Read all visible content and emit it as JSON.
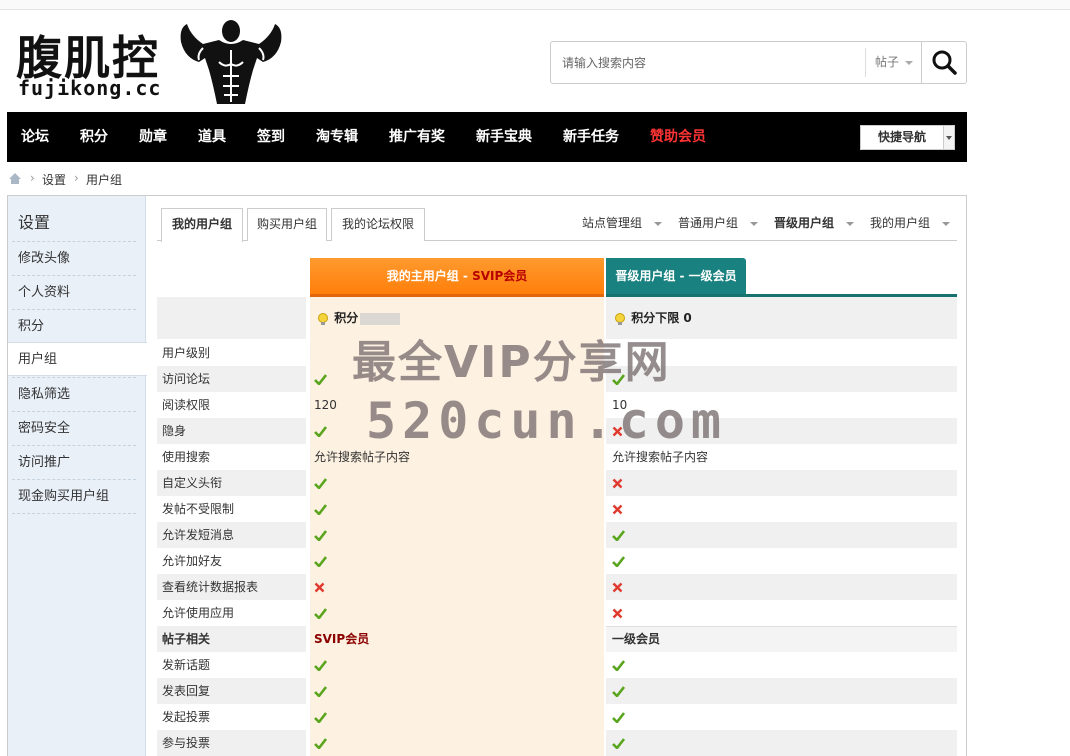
{
  "site": {
    "logo_cn": "腹肌控",
    "logo_en": "fujikong.cc"
  },
  "search": {
    "placeholder": "请输入搜索内容",
    "type_label": "帖子"
  },
  "nav": {
    "items": [
      "论坛",
      "积分",
      "勋章",
      "道具",
      "签到",
      "淘专辑",
      "推广有奖",
      "新手宝典",
      "新手任务",
      "赞助会员"
    ],
    "quick_nav": "快捷导航"
  },
  "breadcrumb": [
    "设置",
    "用户组"
  ],
  "sidebar": {
    "title": "设置",
    "items": [
      "修改头像",
      "个人资料",
      "积分",
      "用户组",
      "隐私筛选",
      "密码安全",
      "访问推广",
      "现金购买用户组"
    ]
  },
  "tabs": {
    "left": [
      "我的用户组",
      "购买用户组",
      "我的论坛权限"
    ],
    "right": [
      "站点管理组",
      "普通用户组",
      "晋级用户组",
      "我的用户组"
    ]
  },
  "table": {
    "main_head_prefix": "我的主用户组 - ",
    "main_head_group": "SVIP会员",
    "next_head": "晋级用户组 - 一级会员",
    "main_points_label": "积分",
    "next_points": "积分下限 0",
    "rows": [
      {
        "label": "用户级别",
        "c1": "",
        "c2": ""
      },
      {
        "label": "访问论坛",
        "c1": "yes",
        "c2": "yes"
      },
      {
        "label": "阅读权限",
        "c1": "120",
        "c2": "10"
      },
      {
        "label": "隐身",
        "c1": "yes",
        "c2": "no"
      },
      {
        "label": "使用搜索",
        "c1": "允许搜索帖子内容",
        "c2": "允许搜索帖子内容"
      },
      {
        "label": "自定义头衔",
        "c1": "yes",
        "c2": "no"
      },
      {
        "label": "发帖不受限制",
        "c1": "yes",
        "c2": "no"
      },
      {
        "label": "允许发短消息",
        "c1": "yes",
        "c2": "yes"
      },
      {
        "label": "允许加好友",
        "c1": "yes",
        "c2": "yes"
      },
      {
        "label": "查看统计数据报表",
        "c1": "no",
        "c2": "no"
      },
      {
        "label": "允许使用应用",
        "c1": "yes",
        "c2": "no"
      },
      {
        "label": "帖子相关",
        "c1": "SVIP会员",
        "c2": "一级会员",
        "section": true
      },
      {
        "label": "发新话题",
        "c1": "yes",
        "c2": "yes"
      },
      {
        "label": "发表回复",
        "c1": "yes",
        "c2": "yes"
      },
      {
        "label": "发起投票",
        "c1": "yes",
        "c2": "yes"
      },
      {
        "label": "参与投票",
        "c1": "yes",
        "c2": "yes"
      }
    ]
  },
  "watermark": {
    "line1": "最全VIP分享网",
    "line2": "520cun.com"
  },
  "colors": {
    "nav_bg": "#000000",
    "nav_highlight": "#ff3333",
    "main_head": "#ff7f0a",
    "next_head": "#19817f",
    "check": "#5aa51e",
    "cross": "#e03a2f"
  }
}
